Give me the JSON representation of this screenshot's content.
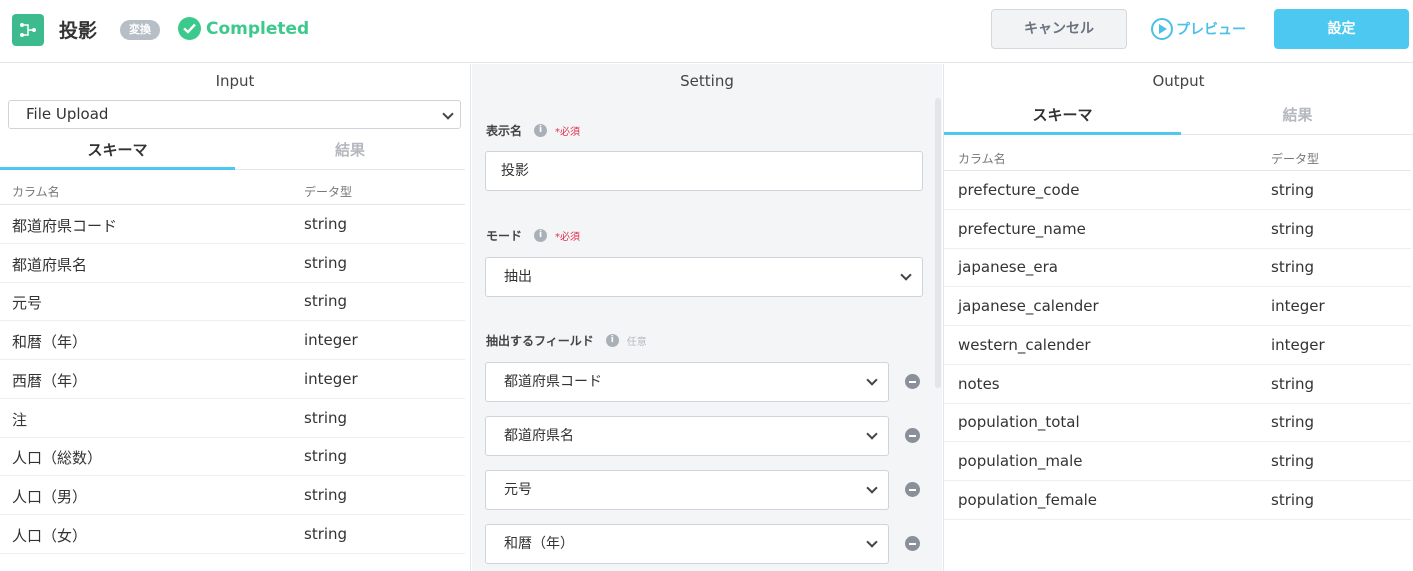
{
  "header": {
    "title": "投影",
    "badge": "変換",
    "status": "Completed",
    "cancel_label": "キャンセル",
    "preview_label": "プレビュー",
    "setting_label": "設定"
  },
  "input": {
    "title": "Input",
    "source": "File Upload",
    "tabs": [
      "スキーマ",
      "結果"
    ],
    "col_name": "カラム名",
    "col_type": "データ型",
    "rows": [
      {
        "name": "都道府県コード",
        "type": "string"
      },
      {
        "name": "都道府県名",
        "type": "string"
      },
      {
        "name": "元号",
        "type": "string"
      },
      {
        "name": "和暦（年）",
        "type": "integer"
      },
      {
        "name": "西暦（年）",
        "type": "integer"
      },
      {
        "name": "注",
        "type": "string"
      },
      {
        "name": "人口（総数）",
        "type": "string"
      },
      {
        "name": "人口（男）",
        "type": "string"
      },
      {
        "name": "人口（女）",
        "type": "string"
      }
    ]
  },
  "setting": {
    "title": "Setting",
    "display_name_label": "表示名",
    "required": "*必須",
    "optional": "任意",
    "display_name_value": "投影",
    "mode_label": "モード",
    "mode_value": "抽出",
    "fields_label": "抽出するフィールド",
    "fields": [
      "都道府県コード",
      "都道府県名",
      "元号",
      "和暦（年）"
    ]
  },
  "output": {
    "title": "Output",
    "tabs": [
      "スキーマ",
      "結果"
    ],
    "col_name": "カラム名",
    "col_type": "データ型",
    "rows": [
      {
        "name": "prefecture_code",
        "type": "string"
      },
      {
        "name": "prefecture_name",
        "type": "string"
      },
      {
        "name": "japanese_era",
        "type": "string"
      },
      {
        "name": "japanese_calender",
        "type": "integer"
      },
      {
        "name": "western_calender",
        "type": "integer"
      },
      {
        "name": "notes",
        "type": "string"
      },
      {
        "name": "population_total",
        "type": "string"
      },
      {
        "name": "population_male",
        "type": "string"
      },
      {
        "name": "population_female",
        "type": "string"
      }
    ]
  }
}
